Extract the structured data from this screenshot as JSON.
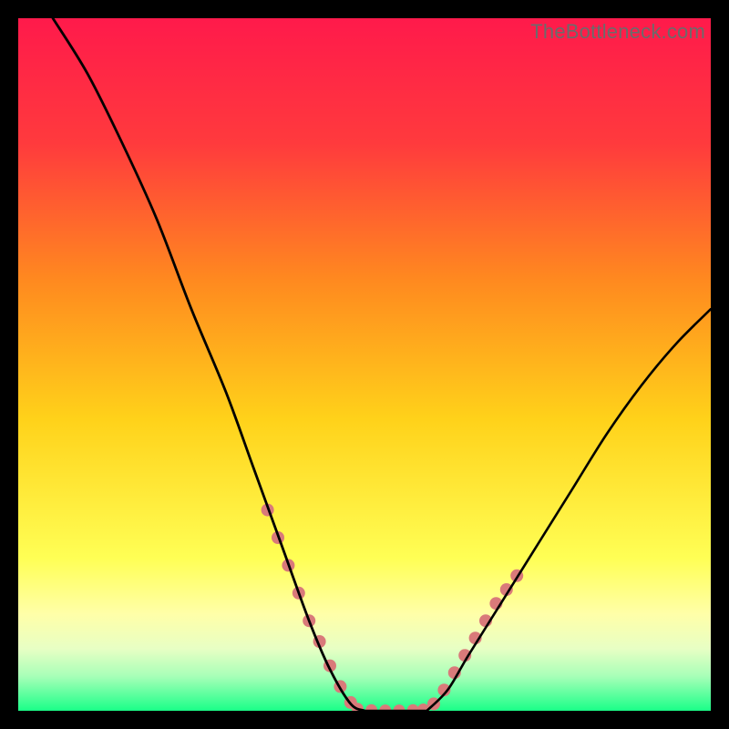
{
  "watermark": "TheBottleneck.com",
  "colors": {
    "top": "#ff1a4b",
    "mid_upper": "#ff6a2a",
    "mid": "#ffd21a",
    "pale_yellow": "#ffff80",
    "pale_green": "#d6ffb0",
    "bottom": "#1aff88",
    "curve": "#000000",
    "dot": "#d97a7a",
    "border": "#000000"
  },
  "chart_data": {
    "type": "line",
    "title": "",
    "xlabel": "",
    "ylabel": "",
    "xlim": [
      0,
      100
    ],
    "ylim": [
      0,
      100
    ],
    "left_curve": [
      {
        "x": 5,
        "y": 100
      },
      {
        "x": 10,
        "y": 92
      },
      {
        "x": 15,
        "y": 82
      },
      {
        "x": 20,
        "y": 71
      },
      {
        "x": 25,
        "y": 58
      },
      {
        "x": 30,
        "y": 46
      },
      {
        "x": 34,
        "y": 35
      },
      {
        "x": 38,
        "y": 24
      },
      {
        "x": 42,
        "y": 13
      },
      {
        "x": 45,
        "y": 6
      },
      {
        "x": 48,
        "y": 1
      },
      {
        "x": 50,
        "y": 0
      }
    ],
    "trough": [
      {
        "x": 50,
        "y": 0
      },
      {
        "x": 59,
        "y": 0
      }
    ],
    "right_curve": [
      {
        "x": 59,
        "y": 0
      },
      {
        "x": 62,
        "y": 3
      },
      {
        "x": 65,
        "y": 8
      },
      {
        "x": 70,
        "y": 16
      },
      {
        "x": 75,
        "y": 24
      },
      {
        "x": 80,
        "y": 32
      },
      {
        "x": 85,
        "y": 40
      },
      {
        "x": 90,
        "y": 47
      },
      {
        "x": 95,
        "y": 53
      },
      {
        "x": 100,
        "y": 58
      }
    ],
    "pink_dots_left": [
      {
        "x": 36,
        "y": 29
      },
      {
        "x": 37.5,
        "y": 25
      },
      {
        "x": 39,
        "y": 21
      },
      {
        "x": 40.5,
        "y": 17
      },
      {
        "x": 42,
        "y": 13
      },
      {
        "x": 43.5,
        "y": 10
      },
      {
        "x": 45,
        "y": 6.5
      },
      {
        "x": 46.5,
        "y": 3.5
      },
      {
        "x": 48,
        "y": 1.2
      }
    ],
    "pink_dots_trough": [
      {
        "x": 49,
        "y": 0.3
      },
      {
        "x": 51,
        "y": 0.1
      },
      {
        "x": 53,
        "y": 0.05
      },
      {
        "x": 55,
        "y": 0.05
      },
      {
        "x": 57,
        "y": 0.1
      },
      {
        "x": 58.5,
        "y": 0.2
      }
    ],
    "pink_dots_right": [
      {
        "x": 60,
        "y": 1
      },
      {
        "x": 61.5,
        "y": 3
      },
      {
        "x": 63,
        "y": 5.5
      },
      {
        "x": 64.5,
        "y": 8
      },
      {
        "x": 66,
        "y": 10.5
      },
      {
        "x": 67.5,
        "y": 13
      },
      {
        "x": 69,
        "y": 15.5
      },
      {
        "x": 70.5,
        "y": 17.5
      },
      {
        "x": 72,
        "y": 19.5
      }
    ]
  }
}
